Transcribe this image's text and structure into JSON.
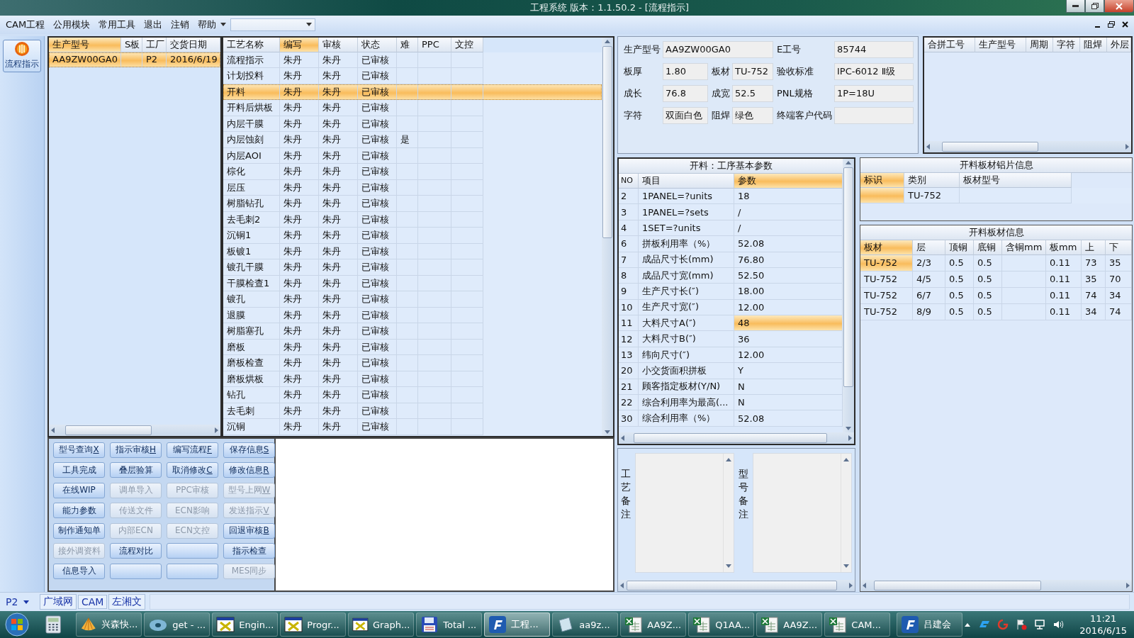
{
  "window": {
    "title": "工程系统   版本：1.1.50.2 - [流程指示]"
  },
  "menu": {
    "items": [
      "CAM工程",
      "公用模块",
      "常用工具",
      "退出",
      "注销",
      "帮助"
    ]
  },
  "sidebar": {
    "items": [
      {
        "label": "流程指示",
        "selected": true
      }
    ]
  },
  "product_table": {
    "columns": [
      {
        "label": "生产型号",
        "selected": true
      },
      {
        "label": "S板",
        "selected": false
      },
      {
        "label": "工厂",
        "selected": false
      },
      {
        "label": "交货日期",
        "selected": false
      }
    ],
    "rows": [
      {
        "model": "AA9ZW00GA0",
        "factory": "P2",
        "delivery_date": "2016/6/19",
        "selected": true
      }
    ]
  },
  "process_table": {
    "columns": [
      {
        "label": "工艺名称",
        "selected": false
      },
      {
        "label": "编写",
        "selected": true
      },
      {
        "label": "审核",
        "selected": false
      },
      {
        "label": "状态",
        "selected": false
      },
      {
        "label": "难",
        "selected": false
      },
      {
        "label": "PPC",
        "selected": false
      },
      {
        "label": "文控",
        "selected": false
      }
    ],
    "rows": [
      {
        "name": "流程指示",
        "writer": "朱丹",
        "reviewer": "朱丹",
        "status": "已审核",
        "selected": false
      },
      {
        "name": "计划投料",
        "writer": "朱丹",
        "reviewer": "朱丹",
        "status": "已审核",
        "selected": false
      },
      {
        "name": "开料",
        "writer": "朱丹",
        "reviewer": "朱丹",
        "status": "已审核",
        "selected": true
      },
      {
        "name": "开料后烘板",
        "writer": "朱丹",
        "reviewer": "朱丹",
        "status": "已审核",
        "selected": false
      },
      {
        "name": "内层干膜",
        "writer": "朱丹",
        "reviewer": "朱丹",
        "status": "已审核",
        "selected": false
      },
      {
        "name": "内层蚀刻",
        "writer": "朱丹",
        "reviewer": "朱丹",
        "status": "已审核",
        "difficult": "是",
        "selected": false
      },
      {
        "name": "内层AOI",
        "writer": "朱丹",
        "reviewer": "朱丹",
        "status": "已审核",
        "selected": false
      },
      {
        "name": "棕化",
        "writer": "朱丹",
        "reviewer": "朱丹",
        "status": "已审核",
        "selected": false
      },
      {
        "name": "层压",
        "writer": "朱丹",
        "reviewer": "朱丹",
        "status": "已审核",
        "selected": false
      },
      {
        "name": "树脂钻孔",
        "writer": "朱丹",
        "reviewer": "朱丹",
        "status": "已审核",
        "selected": false
      },
      {
        "name": "去毛刺2",
        "writer": "朱丹",
        "reviewer": "朱丹",
        "status": "已审核",
        "selected": false
      },
      {
        "name": "沉铜1",
        "writer": "朱丹",
        "reviewer": "朱丹",
        "status": "已审核",
        "selected": false
      },
      {
        "name": "板镀1",
        "writer": "朱丹",
        "reviewer": "朱丹",
        "status": "已审核",
        "selected": false
      },
      {
        "name": "镀孔干膜",
        "writer": "朱丹",
        "reviewer": "朱丹",
        "status": "已审核",
        "selected": false
      },
      {
        "name": "干膜检查1",
        "writer": "朱丹",
        "reviewer": "朱丹",
        "status": "已审核",
        "selected": false
      },
      {
        "name": "镀孔",
        "writer": "朱丹",
        "reviewer": "朱丹",
        "status": "已审核",
        "selected": false
      },
      {
        "name": "退膜",
        "writer": "朱丹",
        "reviewer": "朱丹",
        "status": "已审核",
        "selected": false
      },
      {
        "name": "树脂塞孔",
        "writer": "朱丹",
        "reviewer": "朱丹",
        "status": "已审核",
        "selected": false
      },
      {
        "name": "磨板",
        "writer": "朱丹",
        "reviewer": "朱丹",
        "status": "已审核",
        "selected": false
      },
      {
        "name": "磨板检查",
        "writer": "朱丹",
        "reviewer": "朱丹",
        "status": "已审核",
        "selected": false
      },
      {
        "name": "磨板烘板",
        "writer": "朱丹",
        "reviewer": "朱丹",
        "status": "已审核",
        "selected": false
      },
      {
        "name": "钻孔",
        "writer": "朱丹",
        "reviewer": "朱丹",
        "status": "已审核",
        "selected": false
      },
      {
        "name": "去毛刺",
        "writer": "朱丹",
        "reviewer": "朱丹",
        "status": "已审核",
        "selected": false
      },
      {
        "name": "沉铜",
        "writer": "朱丹",
        "reviewer": "朱丹",
        "status": "已审核",
        "selected": false
      }
    ]
  },
  "action_buttons": [
    {
      "label": "型号查询",
      "hotkey": "X",
      "disabled": false
    },
    {
      "label": "指示审核",
      "hotkey": "H",
      "disabled": false
    },
    {
      "label": "编写流程",
      "hotkey": "F",
      "disabled": false
    },
    {
      "label": "保存信息",
      "hotkey": "S",
      "disabled": false
    },
    {
      "label": "工具完成",
      "disabled": false
    },
    {
      "label": "叠层验算",
      "disabled": false
    },
    {
      "label": "取消修改",
      "hotkey": "C",
      "disabled": false
    },
    {
      "label": "修改信息",
      "hotkey": "R",
      "disabled": false
    },
    {
      "label": "在线WIP",
      "disabled": false
    },
    {
      "label": "调单导入",
      "disabled": true
    },
    {
      "label": "PPC审核",
      "disabled": true
    },
    {
      "label": "型号上网",
      "hotkey": "W",
      "disabled": true
    },
    {
      "label": "能力参数",
      "disabled": false
    },
    {
      "label": "传送文件",
      "disabled": true
    },
    {
      "label": "ECN影响",
      "disabled": true
    },
    {
      "label": "发送指示",
      "hotkey": "V",
      "disabled": true
    },
    {
      "label": "制作通知单",
      "disabled": false
    },
    {
      "label": "内部ECN",
      "disabled": true
    },
    {
      "label": "ECN文控",
      "disabled": true
    },
    {
      "label": "回退审核",
      "hotkey": "B",
      "disabled": false
    },
    {
      "label": "接外调资料",
      "disabled": true
    },
    {
      "label": "流程对比",
      "disabled": false
    },
    {
      "disabled": false
    },
    {
      "label": "指示检查",
      "disabled": false
    },
    {
      "label": "信息导入",
      "disabled": false
    },
    {
      "disabled": false
    },
    {
      "disabled": false
    },
    {
      "label": "MES同步",
      "disabled": true
    }
  ],
  "info_form": {
    "fields": [
      {
        "label": "生产型号",
        "value": "AA9ZW00GA0"
      },
      {
        "label": "E工号",
        "value": "85744"
      },
      {
        "label": "板厚",
        "value": "1.80"
      },
      {
        "label": "板材",
        "value": "TU-752"
      },
      {
        "label": "验收标准",
        "value": "IPC-6012 Ⅱ级"
      },
      {
        "label": "成长",
        "value": "76.8"
      },
      {
        "label": "成宽",
        "value": "52.5"
      },
      {
        "label": "PNL规格",
        "value": "1P=18U"
      },
      {
        "label": "字符",
        "value": "双面白色"
      },
      {
        "label": "阻焊",
        "value": "绿色"
      },
      {
        "label": "终端客户代码"
      }
    ]
  },
  "merge_table": {
    "columns": [
      "合拼工号",
      "生产型号",
      "周期",
      "字符",
      "阻焊",
      "外层"
    ]
  },
  "params_table": {
    "title": "开料：工序基本参数",
    "columns": [
      {
        "label": "NO",
        "selected": false
      },
      {
        "label": "项目",
        "selected": false
      },
      {
        "label": "参数",
        "selected": true
      }
    ],
    "rows": [
      {
        "no": "2",
        "item": "1PANEL=?units",
        "value": "18",
        "selected": false
      },
      {
        "no": "3",
        "item": "1PANEL=?sets",
        "value": "/",
        "selected": false
      },
      {
        "no": "4",
        "item": "1SET=?units",
        "value": "/",
        "selected": false
      },
      {
        "no": "6",
        "item": "拼板利用率（%）",
        "value": "52.08",
        "selected": false
      },
      {
        "no": "7",
        "item": "成品尺寸长(mm)",
        "value": "76.80",
        "selected": false
      },
      {
        "no": "8",
        "item": "成品尺寸宽(mm)",
        "value": "52.50",
        "selected": false
      },
      {
        "no": "9",
        "item": "生产尺寸长(″)",
        "value": "18.00",
        "selected": false
      },
      {
        "no": "10",
        "item": "生产尺寸宽(″)",
        "value": "12.00",
        "selected": false
      },
      {
        "no": "11",
        "item": "大料尺寸A(″)",
        "value": "48",
        "selected": true
      },
      {
        "no": "12",
        "item": "大料尺寸B(″)",
        "value": "36",
        "selected": false
      },
      {
        "no": "13",
        "item": "纬向尺寸(″)",
        "value": "12.00",
        "selected": false
      },
      {
        "no": "20",
        "item": "小交货面积拼板",
        "value": "Y",
        "selected": false
      },
      {
        "no": "21",
        "item": "顾客指定板材(Y/N)",
        "value": "N",
        "selected": false
      },
      {
        "no": "22",
        "item": "综合利用率为最高(...",
        "value": "N",
        "selected": false
      },
      {
        "no": "30",
        "item": "综合利用率（%）",
        "value": "52.08",
        "selected": false
      }
    ]
  },
  "notes": [
    {
      "label": "工艺备注"
    },
    {
      "label": "型号备注"
    }
  ],
  "aluminum_table": {
    "title": "开料板材铝片信息",
    "columns": [
      {
        "label": "标识",
        "selected": true
      },
      {
        "label": "类别",
        "selected": false
      },
      {
        "label": "板材型号",
        "selected": false
      }
    ],
    "rows": [
      {
        "category": "TU-752",
        "selected": true
      }
    ]
  },
  "board_table": {
    "title": "开料板材信息",
    "columns": [
      {
        "label": "板材",
        "selected": true
      },
      {
        "label": "层",
        "selected": false
      },
      {
        "label": "顶铜",
        "selected": false
      },
      {
        "label": "底铜",
        "selected": false
      },
      {
        "label": "含铜mm",
        "selected": false
      },
      {
        "label": "板mm",
        "selected": false
      },
      {
        "label": "上",
        "selected": false
      },
      {
        "label": "下",
        "selected": false
      }
    ],
    "rows": [
      {
        "board": "TU-752",
        "layer": "2/3",
        "top_cu": "0.5",
        "bottom_cu": "0.5",
        "board_mm": "0.11",
        "up": "73",
        "down": "35",
        "selected": true
      },
      {
        "board": "TU-752",
        "layer": "4/5",
        "top_cu": "0.5",
        "bottom_cu": "0.5",
        "board_mm": "0.11",
        "up": "35",
        "down": "70",
        "selected": false
      },
      {
        "board": "TU-752",
        "layer": "6/7",
        "top_cu": "0.5",
        "bottom_cu": "0.5",
        "board_mm": "0.11",
        "up": "74",
        "down": "34",
        "selected": false
      },
      {
        "board": "TU-752",
        "layer": "8/9",
        "top_cu": "0.5",
        "bottom_cu": "0.5",
        "board_mm": "0.11",
        "up": "34",
        "down": "74",
        "selected": false
      }
    ]
  },
  "status_bar": {
    "plant": "P2",
    "tabs": [
      "广域网",
      "CAM",
      "左湘文"
    ]
  },
  "taskbar": {
    "items": [
      {
        "label": "兴森快...",
        "selected": false
      },
      {
        "label": "get - ...",
        "selected": false
      },
      {
        "label": "Engin...",
        "selected": false
      },
      {
        "label": "Progr...",
        "selected": false
      },
      {
        "label": "Graph...",
        "selected": false
      },
      {
        "label": "Total ...",
        "selected": false
      },
      {
        "label": "工程...",
        "selected": true
      },
      {
        "label": "aa9z...",
        "selected": false
      },
      {
        "label": "AA9Z...",
        "selected": false
      },
      {
        "label": "Q1AA...",
        "selected": false
      },
      {
        "label": "AA9Z...",
        "selected": false
      },
      {
        "label": "CAM...",
        "selected": false
      },
      {
        "label": "吕建会",
        "selected": false
      }
    ],
    "time": "11:21",
    "date": "2016/6/15"
  }
}
